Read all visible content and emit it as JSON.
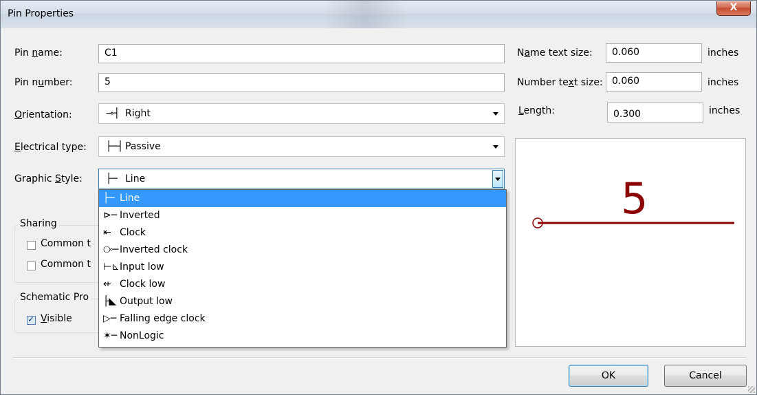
{
  "window": {
    "title": "Pin Properties",
    "close_glyph": "X"
  },
  "fields": {
    "pin_name": {
      "label_pre": "Pin ",
      "label_u": "n",
      "label_post": "ame:",
      "value": "C1"
    },
    "pin_number": {
      "label_pre": "Pin n",
      "label_u": "u",
      "label_post": "mber:",
      "value": "5"
    },
    "orientation": {
      "label_pre": "",
      "label_u": "O",
      "label_post": "rientation:",
      "icon": "⊸┤",
      "value": "Right"
    },
    "electrical_type": {
      "label_pre": "",
      "label_u": "E",
      "label_post": "lectrical type:",
      "icon": "├─┤",
      "value": "Passive"
    },
    "graphic_style": {
      "label_pre": "Graphic ",
      "label_u": "S",
      "label_post": "tyle:",
      "icon": "├─",
      "value": "Line"
    }
  },
  "right_fields": {
    "name_text_size": {
      "label_pre": "N",
      "label_u": "a",
      "label_post": "me text size:",
      "value": "0.060",
      "unit": "inches"
    },
    "number_text_size": {
      "label_pre": "Number te",
      "label_u": "x",
      "label_post": "t size:",
      "value": "0.060",
      "unit": "inches"
    },
    "length": {
      "label_pre": "",
      "label_u": "L",
      "label_post": "ength:",
      "value": "0.300",
      "unit": "inches"
    }
  },
  "sharing": {
    "title": "Sharing",
    "option1": "Common t",
    "option2": "Common t"
  },
  "schematic": {
    "title": "Schematic Pro",
    "visible_u": "V",
    "visible_rest": "isible"
  },
  "preview": {
    "pin_number": "5",
    "color": "#8b0000"
  },
  "dropdown": {
    "items": [
      {
        "icon": "├─",
        "label": "Line"
      },
      {
        "icon": "⊳─",
        "label": "Inverted"
      },
      {
        "icon": "⇤",
        "label": "Clock"
      },
      {
        "icon": "⧂─",
        "label": "Inverted clock"
      },
      {
        "icon": "⊢⊾",
        "label": "Input low"
      },
      {
        "icon": "⇷",
        "label": "Clock low"
      },
      {
        "icon": "├◣",
        "label": "Output low"
      },
      {
        "icon": "▷─",
        "label": "Falling edge clock"
      },
      {
        "icon": "✶─",
        "label": "NonLogic"
      }
    ],
    "selected_index": 0
  },
  "buttons": {
    "ok": "OK",
    "cancel": "Cancel"
  },
  "colors": {
    "selection": "#3399ff",
    "preview_pin": "#8b0000"
  }
}
